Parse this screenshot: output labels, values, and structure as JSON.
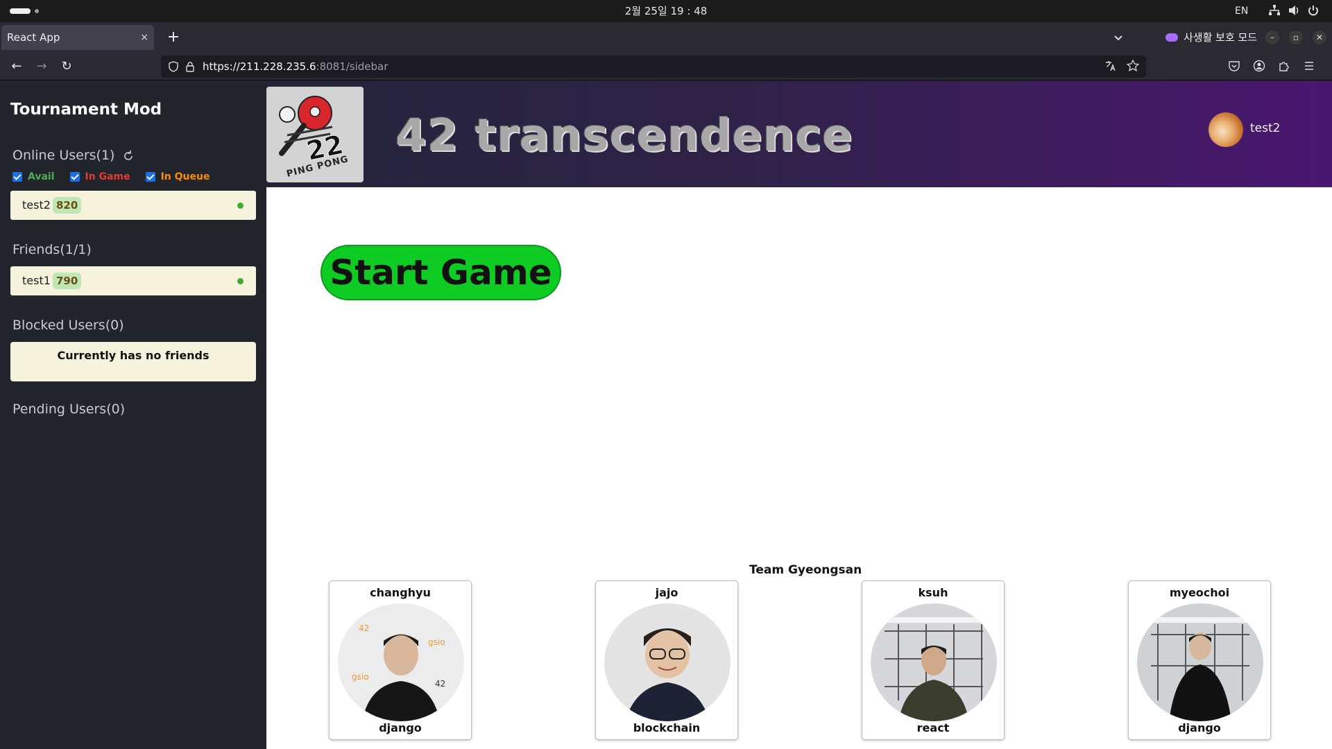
{
  "os": {
    "clock": "2월 25일 19 : 48",
    "lang": "EN"
  },
  "browser": {
    "tab_title": "React App",
    "tab_close": "×",
    "new_tab": "+",
    "private_mode": "사생활 보호 모드",
    "url_host": "https://211.228.235.6",
    "url_rest": ":8081/sidebar"
  },
  "sidebar": {
    "title": "Tournament Mod",
    "online": {
      "label": "Online Users(1)",
      "filters": [
        {
          "label": "Avail",
          "color": "#4caf50"
        },
        {
          "label": "In Game",
          "color": "#e53935"
        },
        {
          "label": "In Queue",
          "color": "#fb8c00"
        }
      ],
      "users": [
        {
          "name": "test2",
          "score": "820"
        }
      ]
    },
    "friends": {
      "label": "Friends(1/1)",
      "users": [
        {
          "name": "test1",
          "score": "790"
        }
      ]
    },
    "blocked": {
      "label": "Blocked Users(0)",
      "empty": "Currently has no friends"
    },
    "pending": {
      "label": "Pending Users(0)"
    }
  },
  "header": {
    "logo_text": "PING PONG",
    "title": "42 transcendence",
    "user": "test2"
  },
  "main": {
    "start_button": "Start Game",
    "team_title": "Team Gyeongsan",
    "members": [
      {
        "name": "changhyu",
        "role": "django"
      },
      {
        "name": "jajo",
        "role": "blockchain"
      },
      {
        "name": "ksuh",
        "role": "react"
      },
      {
        "name": "myeochoi",
        "role": "django"
      }
    ]
  },
  "colors": {
    "sidebar_bg": "#22252b",
    "start_green": "#0ecc23",
    "card_bg": "#f5f3dc",
    "score_bg": "#bfe6b3"
  }
}
